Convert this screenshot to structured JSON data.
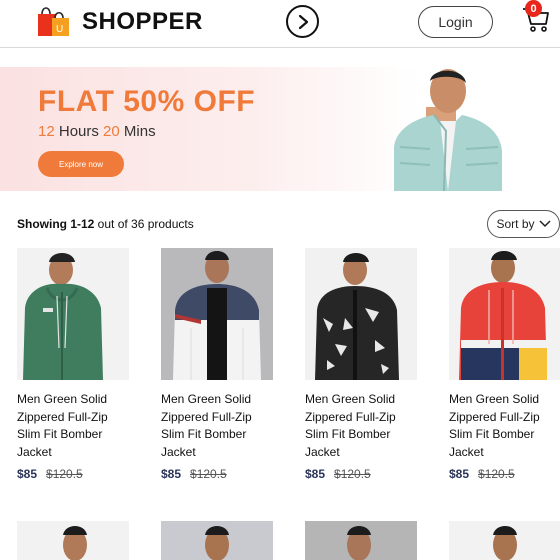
{
  "header": {
    "brand": "SHOPPER",
    "login_label": "Login",
    "cart_count": "0",
    "colors": {
      "bag_red": "#e8321c",
      "bag_orange": "#f5a020",
      "accent": "#f07a3a"
    }
  },
  "banner": {
    "headline": "FLAT 50% OFF",
    "timer_hours": "12",
    "timer_hours_label": " Hours ",
    "timer_mins": "20",
    "timer_mins_label": " Mins",
    "cta_label": "Explore now"
  },
  "toolbar": {
    "showing_range": "Showing 1-12",
    "showing_rest": " out of 36 products",
    "sort_label": "Sort by"
  },
  "products": [
    {
      "name": "Men Green Solid Zippered Full-Zip Slim Fit Bomber Jacket",
      "price": "$85",
      "old_price": "$120.5"
    },
    {
      "name": "Men Green Solid Zippered Full-Zip Slim Fit Bomber Jacket",
      "price": "$85",
      "old_price": "$120.5"
    },
    {
      "name": "Men Green Solid Zippered Full-Zip Slim Fit Bomber Jacket",
      "price": "$85",
      "old_price": "$120.5"
    },
    {
      "name": "Men Green Solid Zippered Full-Zip Slim Fit Bomber Jacket",
      "price": "$85",
      "old_price": "$120.5"
    }
  ]
}
